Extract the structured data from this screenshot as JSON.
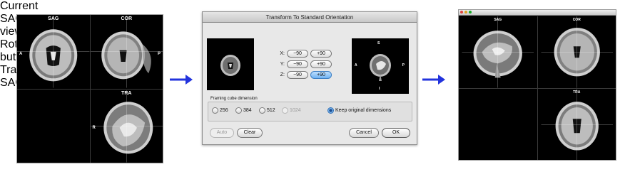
{
  "left_viewer": {
    "panes": {
      "sag": "SAG",
      "cor": "COR",
      "tra": "TRA"
    },
    "orient": {
      "a": "A",
      "p": "P",
      "r": "R"
    }
  },
  "dialog": {
    "title": "Transform To Standard Orientation",
    "current_view_label": "Current SAG view",
    "rotation_label": "Rotation buttons",
    "transformed_view_label": "Transformed SAG view",
    "rotation_rows": [
      {
        "axis": "X:",
        "minus": "−90",
        "plus": "+90"
      },
      {
        "axis": "Y:",
        "minus": "−90",
        "plus": "+90"
      },
      {
        "axis": "Z:",
        "minus": "−90",
        "plus": "+90"
      }
    ],
    "transformed_orient": {
      "s": "S",
      "a": "A",
      "p": "P",
      "i": "I"
    },
    "framing_legend": "Framing cube dimension",
    "framing_options": [
      "256",
      "384",
      "512",
      "1024"
    ],
    "keep_original_label": "Keep original dimensions",
    "buttons": {
      "auto": "Auto",
      "clear": "Clear",
      "cancel": "Cancel",
      "ok": "OK"
    }
  },
  "right_viewer": {
    "panes": {
      "sag": "SAG",
      "cor": "COR",
      "tra": "TRA"
    }
  },
  "colors": {
    "arrow": "#2233dd",
    "active_button": "#6fb2f2"
  }
}
